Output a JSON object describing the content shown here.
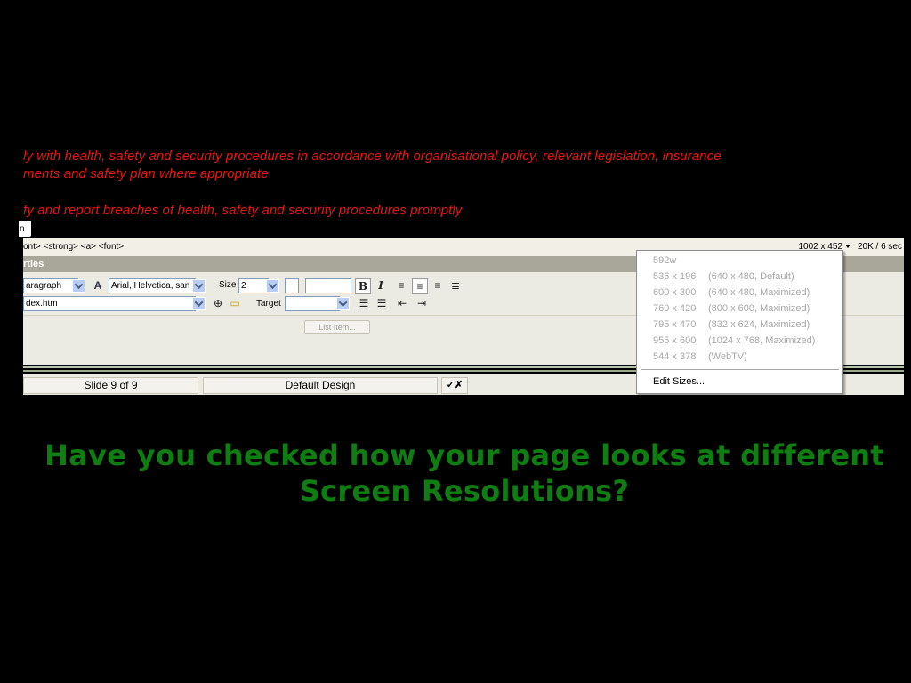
{
  "document": {
    "lines": [
      "ly with health, safety and security procedures in accordance with organisational policy, relevant legislation, insurance",
      "ments and safety plan where appropriate",
      "fy and report breaches of health, safety and security procedures promptly"
    ],
    "cursor_char": "n"
  },
  "tag_bar": {
    "tags": "ont> <strong> <a> <font>",
    "window_size": "1002 x 452",
    "download_stats": "20K / 6 sec"
  },
  "properties": {
    "title": "rties",
    "format_value": "aragraph",
    "font_value": "Arial, Helvetica, san",
    "size_label": "Size",
    "size_value": "2",
    "link_value": "dex.htm",
    "target_label": "Target",
    "list_item_button": "List Item...",
    "bold_glyph": "B",
    "italic_glyph": "I"
  },
  "status": {
    "slide": "Slide 9 of 9",
    "design": "Default Design"
  },
  "size_menu": {
    "items": [
      {
        "dims": "592w",
        "desc": ""
      },
      {
        "dims": "536 x 196",
        "desc": "(640 x 480, Default)"
      },
      {
        "dims": "600 x 300",
        "desc": "(640 x 480, Maximized)"
      },
      {
        "dims": "760 x 420",
        "desc": "(800 x 600, Maximized)"
      },
      {
        "dims": "795 x 470",
        "desc": "(832 x 624, Maximized)"
      },
      {
        "dims": "955 x 600",
        "desc": "(1024 x 768, Maximized)"
      },
      {
        "dims": "544 x 378",
        "desc": "(WebTV)"
      }
    ],
    "edit_sizes": "Edit Sizes..."
  },
  "caption": {
    "line1": "Have you checked how your page looks at different",
    "line2": "Screen Resolutions?"
  },
  "colors": {
    "background": "#000000",
    "doc_text": "#e8160e",
    "caption": "#0f7d12",
    "panel": "#ecebe3"
  }
}
